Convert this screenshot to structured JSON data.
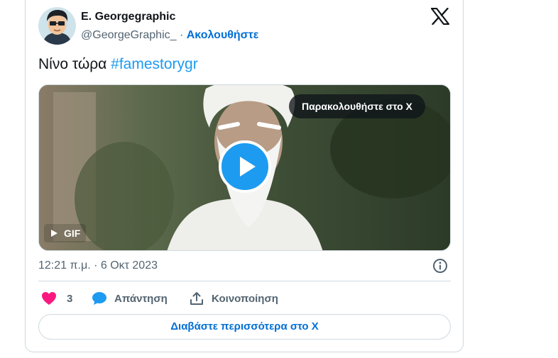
{
  "author": {
    "name": "E. Georgegraphic",
    "handle": "@GeorgeGraphic_",
    "separator": " · ",
    "follow_label": "Ακολουθήστε"
  },
  "tweet": {
    "text": "Νίνο τώρα ",
    "hashtag": "#famestorygr"
  },
  "media": {
    "watch_label": "Παρακολουθήστε στο X",
    "gif_label": "GIF",
    "play_icon": "play-icon"
  },
  "timestamp": "12:21 π.μ. · 6 Οκτ 2023",
  "actions": {
    "likes_count": "3",
    "reply_label": "Απάντηση",
    "share_label": "Κοινοποίηση"
  },
  "read_more_label": "Διαβάστε περισσότερα στο X",
  "colors": {
    "accent": "#1d9bf0",
    "link": "#006fd6",
    "like": "#f91880",
    "muted": "#536471",
    "border": "#cfd9de"
  }
}
